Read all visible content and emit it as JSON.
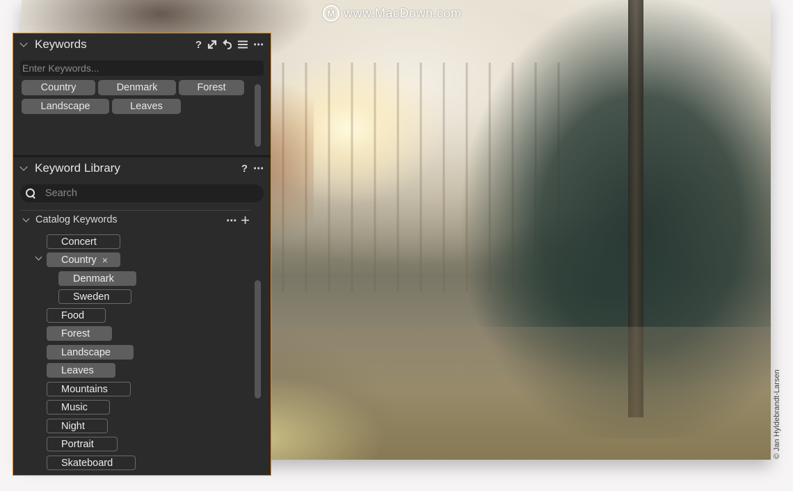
{
  "watermark": {
    "logo": "M",
    "text": "www.MacDown.com"
  },
  "photo": {
    "credit": "© Jan Hyldebrandt-Larsen",
    "subject": "sunlit forest with spruce tree"
  },
  "colors": {
    "panel_bg": "#2b2b2b",
    "panel_border": "#e08a1e",
    "tag_bg": "#5e5e5e",
    "page_bg": "#f6f4f4"
  },
  "keywords_panel": {
    "title": "Keywords",
    "icons": [
      "help-icon",
      "expand-icon",
      "reset-icon",
      "menu-icon",
      "more-icon"
    ],
    "icon_glyphs": {
      "help": "?",
      "more": "⋯"
    },
    "input_placeholder": "Enter Keywords...",
    "input_value": "",
    "tags": [
      "Country",
      "Denmark",
      "Forest",
      "Landscape",
      "Leaves"
    ]
  },
  "library_panel": {
    "title": "Keyword Library",
    "icon_glyphs": {
      "help": "?",
      "more": "⋯",
      "add": "+"
    },
    "search_placeholder": "Search",
    "search_value": "",
    "catalog_label": "Catalog Keywords",
    "remove_glyph": "×",
    "items": [
      {
        "label": "Concert",
        "applied": false,
        "level": 0
      },
      {
        "label": "Country",
        "applied": true,
        "level": 0,
        "expanded": true,
        "removable": true
      },
      {
        "label": "Denmark",
        "applied": true,
        "level": 1
      },
      {
        "label": "Sweden",
        "applied": false,
        "level": 1
      },
      {
        "label": "Food",
        "applied": false,
        "level": 0
      },
      {
        "label": "Forest",
        "applied": true,
        "level": 0
      },
      {
        "label": "Landscape",
        "applied": true,
        "level": 0
      },
      {
        "label": "Leaves",
        "applied": true,
        "level": 0
      },
      {
        "label": "Mountains",
        "applied": false,
        "level": 0
      },
      {
        "label": "Music",
        "applied": false,
        "level": 0
      },
      {
        "label": "Night",
        "applied": false,
        "level": 0
      },
      {
        "label": "Portrait",
        "applied": false,
        "level": 0
      },
      {
        "label": "Skateboard",
        "applied": false,
        "level": 0
      }
    ]
  }
}
